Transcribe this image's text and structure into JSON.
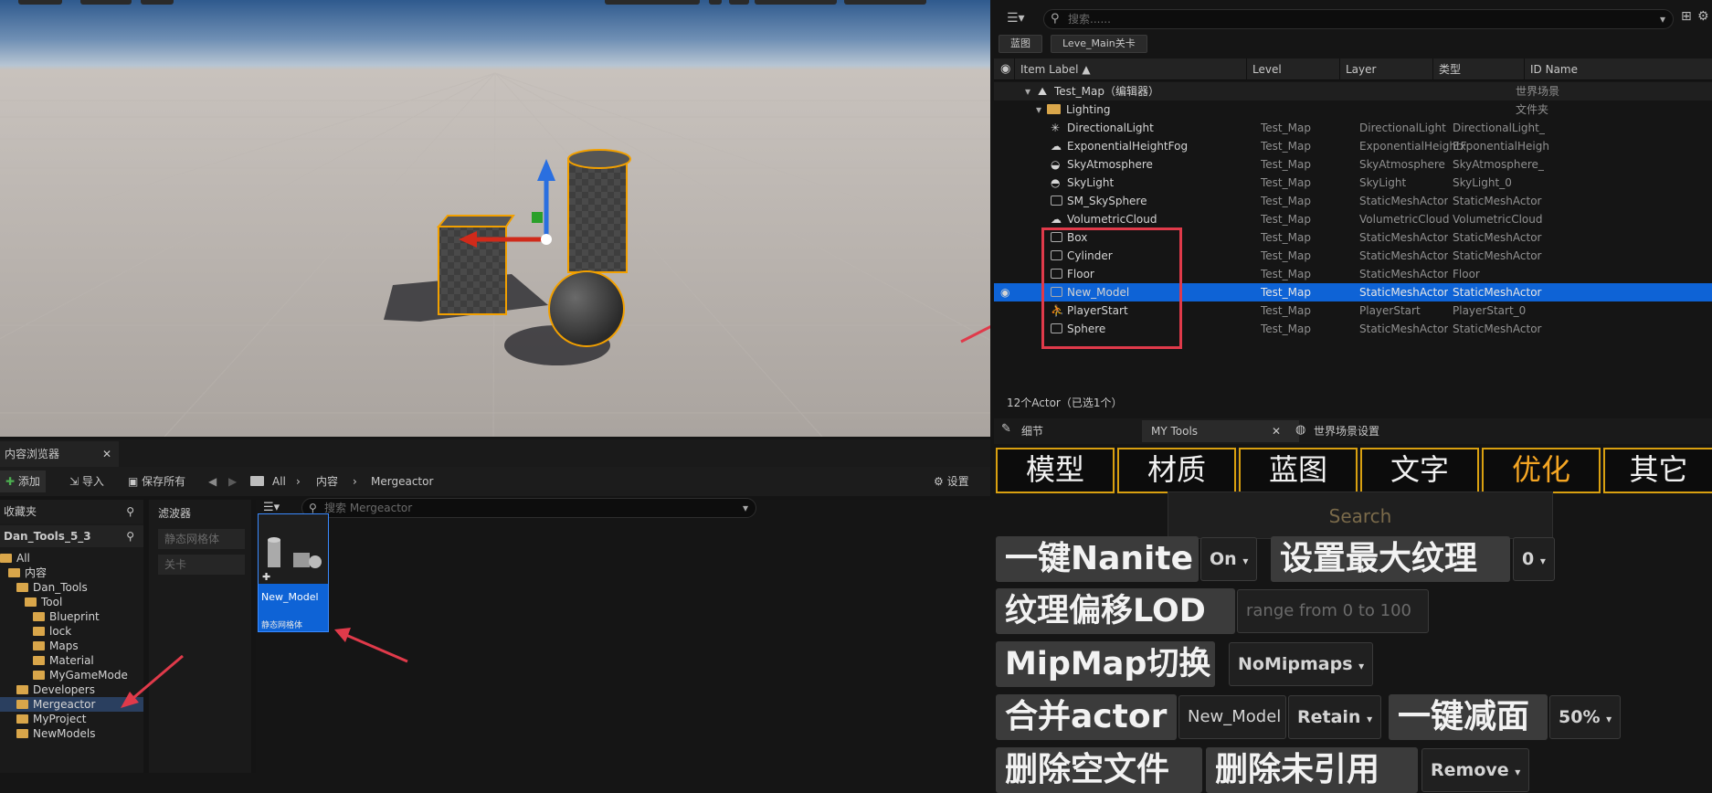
{
  "outliner": {
    "search_placeholder": "搜索......",
    "chips": [
      "蓝图",
      "Leve_Main关卡"
    ],
    "columns": [
      "Item Label ▲",
      "Level",
      "Layer",
      "类型",
      "ID Name"
    ],
    "map_label": "Test_Map（编辑器）",
    "map_type": "世界场景",
    "folder_label": "Lighting",
    "folder_type": "文件夹",
    "rows": [
      {
        "label": "DirectionalLight",
        "icon": "directional-light-icon",
        "level": "Test_Map",
        "type": "DirectionalLight",
        "id": "DirectionalLight_"
      },
      {
        "label": "ExponentialHeightFog",
        "icon": "fog-icon",
        "level": "Test_Map",
        "type": "ExponentialHeightF",
        "id": "ExponentialHeigh"
      },
      {
        "label": "SkyAtmosphere",
        "icon": "sky-atmosphere-icon",
        "level": "Test_Map",
        "type": "SkyAtmosphere",
        "id": "SkyAtmosphere_"
      },
      {
        "label": "SkyLight",
        "icon": "sky-light-icon",
        "level": "Test_Map",
        "type": "SkyLight",
        "id": "SkyLight_0"
      },
      {
        "label": "SM_SkySphere",
        "icon": "static-mesh-icon",
        "level": "Test_Map",
        "type": "StaticMeshActor",
        "id": "StaticMeshActor"
      },
      {
        "label": "VolumetricCloud",
        "icon": "cloud-icon",
        "level": "Test_Map",
        "type": "VolumetricCloud",
        "id": "VolumetricCloud"
      },
      {
        "label": "Box",
        "icon": "static-mesh-icon",
        "level": "Test_Map",
        "type": "StaticMeshActor",
        "id": "StaticMeshActor"
      },
      {
        "label": "Cylinder",
        "icon": "static-mesh-icon",
        "level": "Test_Map",
        "type": "StaticMeshActor",
        "id": "StaticMeshActor"
      },
      {
        "label": "Floor",
        "icon": "static-mesh-icon",
        "level": "Test_Map",
        "type": "StaticMeshActor",
        "id": "Floor"
      },
      {
        "label": "New_Model",
        "icon": "static-mesh-icon",
        "level": "Test_Map",
        "type": "StaticMeshActor",
        "id": "StaticMeshActor"
      },
      {
        "label": "PlayerStart",
        "icon": "player-start-icon",
        "level": "Test_Map",
        "type": "PlayerStart",
        "id": "PlayerStart_0"
      },
      {
        "label": "Sphere",
        "icon": "static-mesh-icon",
        "level": "Test_Map",
        "type": "StaticMeshActor",
        "id": "StaticMeshActor"
      }
    ],
    "status": "12个Actor（已选1个）"
  },
  "tools": {
    "tabs": [
      "细节",
      "MY Tools",
      "世界场景设置"
    ],
    "categories": [
      "模型",
      "材质",
      "蓝图",
      "文字",
      "优化",
      "其它"
    ],
    "search": "Search",
    "nanite_btn": "一键Nanite",
    "nanite_value": "On",
    "max_texture_btn": "设置最大纹理",
    "max_texture_value": "0",
    "lod_btn": "纹理偏移LOD",
    "lod_placeholder": "range from 0 to 100",
    "mipmap_btn": "MipMap切换",
    "mipmap_value": "NoMipmaps",
    "merge_btn": "合并actor",
    "merge_name": "New_Model",
    "merge_value": "Retain",
    "reduce_btn": "一键减面",
    "reduce_value": "50%",
    "delete_empty_btn": "删除空文件",
    "delete_unref_btn": "删除未引用",
    "remove_value": "Remove"
  },
  "content_browser": {
    "tab": "内容浏览器",
    "add": "添加",
    "import": "导入",
    "save_all": "保存所有",
    "path": [
      "All",
      "内容",
      "Mergeactor"
    ],
    "settings": "设置",
    "favorites": "收藏夹",
    "project": "Dan_Tools_5_3",
    "filters_title": "滤波器",
    "filters": [
      "静态网格体",
      "关卡"
    ],
    "search_placeholder": "搜索 Mergeactor",
    "tree": [
      {
        "label": "All",
        "indent": 0
      },
      {
        "label": "内容",
        "indent": 1
      },
      {
        "label": "Dan_Tools",
        "indent": 2
      },
      {
        "label": "Tool",
        "indent": 3
      },
      {
        "label": "Blueprint",
        "indent": 4
      },
      {
        "label": "lock",
        "indent": 4
      },
      {
        "label": "Maps",
        "indent": 4
      },
      {
        "label": "Material",
        "indent": 4
      },
      {
        "label": "MyGameMode",
        "indent": 4
      },
      {
        "label": "Developers",
        "indent": 2
      },
      {
        "label": "Mergeactor",
        "indent": 2
      },
      {
        "label": "MyProject",
        "indent": 2
      },
      {
        "label": "NewModels",
        "indent": 2
      }
    ],
    "asset_name": "New_Model",
    "asset_type": "静态网格体"
  },
  "colors": {
    "selection": "#0e63d6",
    "accent": "#d9a010",
    "highlight_box": "#e03a4a"
  }
}
